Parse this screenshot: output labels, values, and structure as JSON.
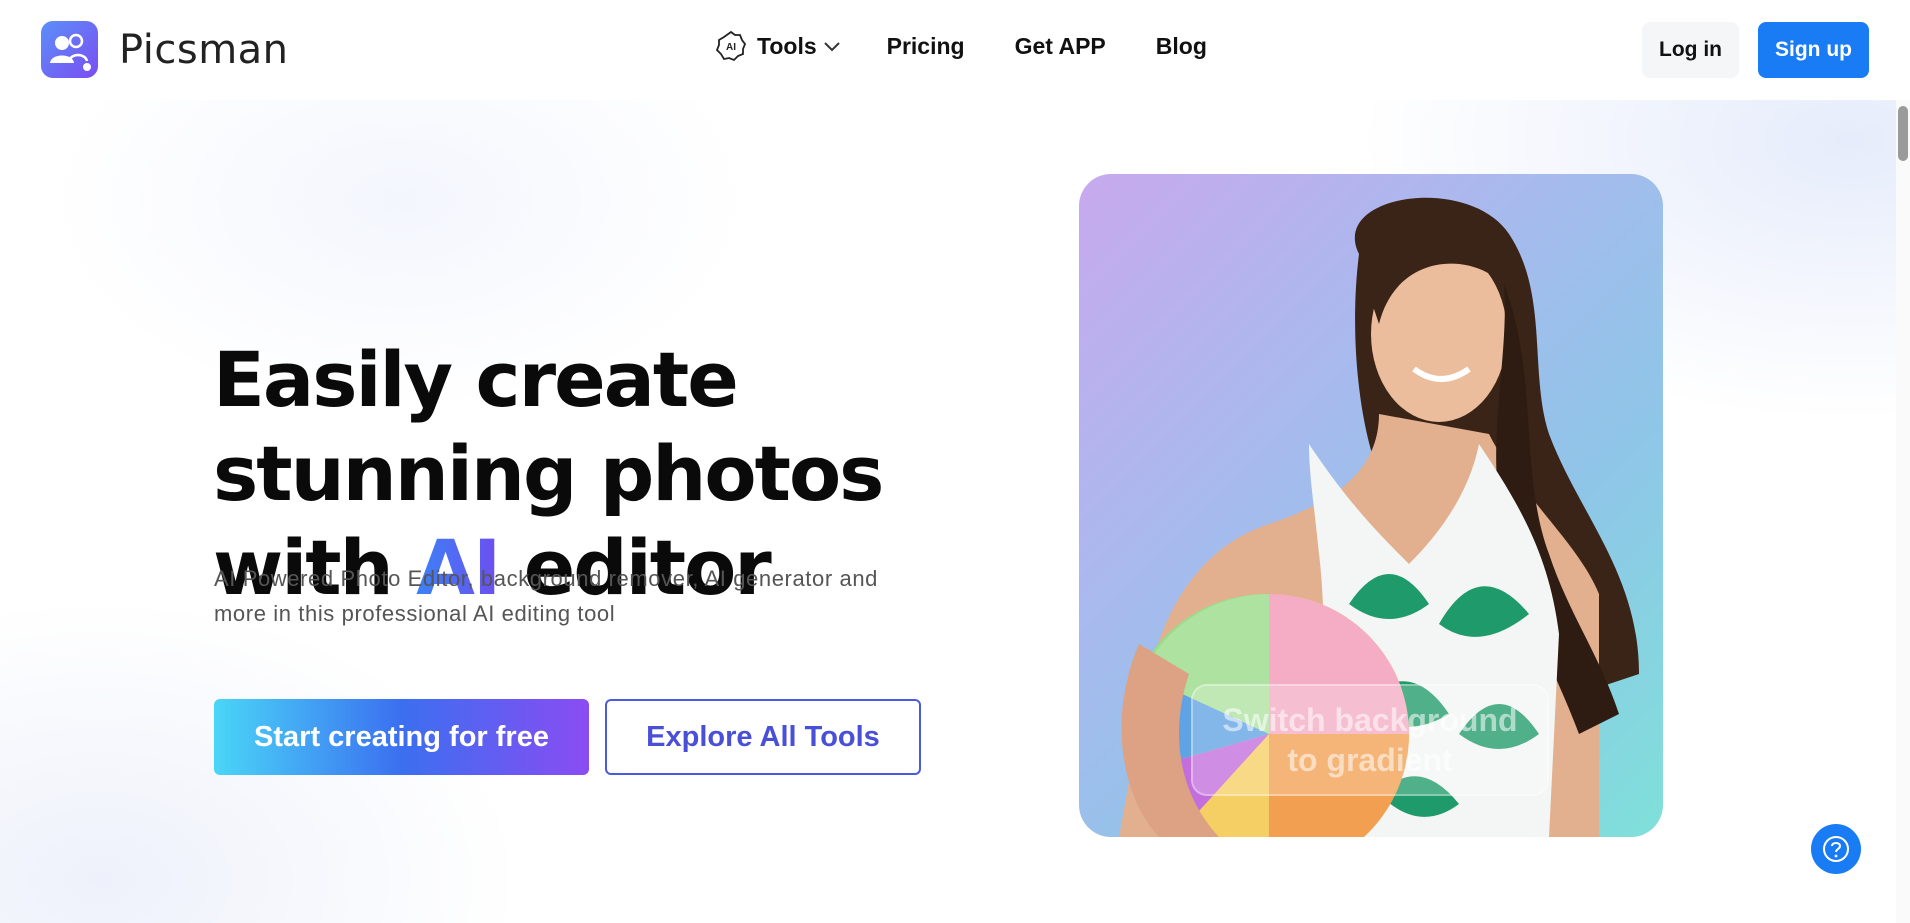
{
  "brand": {
    "name": "Picsman"
  },
  "nav": {
    "items": [
      {
        "label": "Tools",
        "icon": "ai-badge-icon",
        "has_dropdown": true
      },
      {
        "label": "Pricing"
      },
      {
        "label": "Get APP"
      },
      {
        "label": "Blog"
      }
    ]
  },
  "auth": {
    "login_label": "Log in",
    "signup_label": "Sign up"
  },
  "hero": {
    "headline_line1": "Easily create",
    "headline_line2": "stunning photos",
    "headline_with": "with",
    "headline_ai": "AI",
    "headline_editor": "editor",
    "subtitle": "AI Powered Photo Editor, background remover, AI generator and more in this professional AI editing tool",
    "primary_cta": "Start creating for free",
    "secondary_cta": "Explore All Tools"
  },
  "showcase": {
    "overlay_text": "Switch background to gradient"
  },
  "colors": {
    "accent": "#1a7cf5",
    "cta_gradient_start": "#4ad6f7",
    "cta_gradient_end": "#8a4cf3",
    "secondary_border": "#4b5be0"
  }
}
